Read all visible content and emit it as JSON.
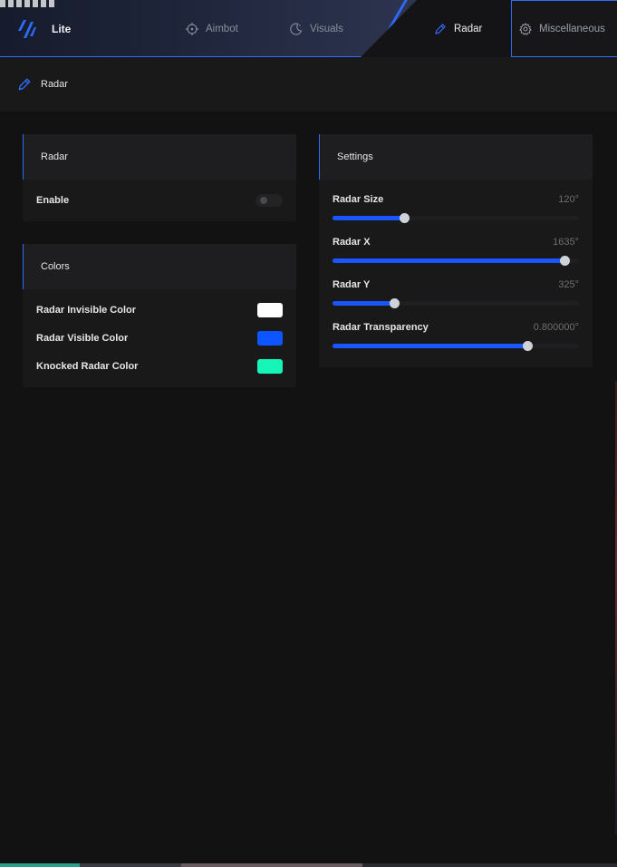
{
  "header": {
    "brand": "Lite",
    "tabs": [
      {
        "label": "Aimbot",
        "icon": "crosshair-icon",
        "active": false
      },
      {
        "label": "Visuals",
        "icon": "moon-icon",
        "active": false
      },
      {
        "label": "Radar",
        "icon": "pen-icon",
        "active": true
      },
      {
        "label": "Miscellaneous",
        "icon": "gear-icon",
        "active": false
      }
    ]
  },
  "subheader": {
    "title": "Radar",
    "icon": "pen-icon"
  },
  "radar_panel": {
    "title": "Radar",
    "enable_label": "Enable",
    "enabled": false
  },
  "colors_panel": {
    "title": "Colors",
    "items": [
      {
        "label": "Radar Invisible Color",
        "color": "#ffffff"
      },
      {
        "label": "Radar Visible Color",
        "color": "#0d55ff"
      },
      {
        "label": "Knocked Radar Color",
        "color": "#15f5b8"
      }
    ]
  },
  "settings_panel": {
    "title": "Settings",
    "sliders": [
      {
        "label": "Radar Size",
        "value": "120°",
        "fraction": 0.29
      },
      {
        "label": "Radar X",
        "value": "1635°",
        "fraction": 0.94
      },
      {
        "label": "Radar Y",
        "value": "325°",
        "fraction": 0.25
      },
      {
        "label": "Radar Transparency",
        "value": "0.800000°",
        "fraction": 0.79
      }
    ]
  },
  "accent_color": "#2f6bff"
}
